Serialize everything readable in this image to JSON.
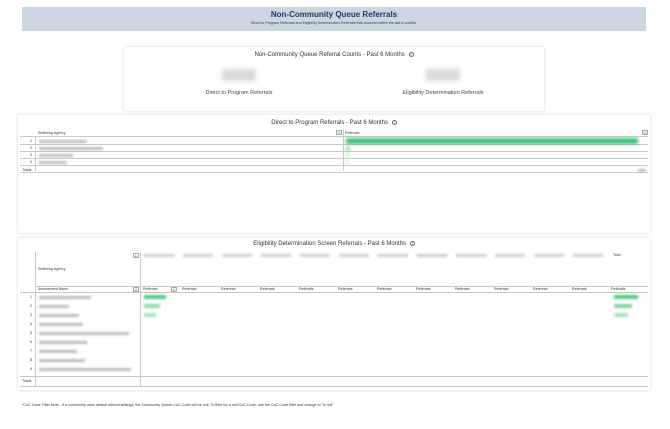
{
  "header": {
    "title": "Non-Community Queue Referrals",
    "subtitle": "Direct to Program Referrals and Eligibility Determination Referrals that occurred within the last 6 months."
  },
  "counts_card": {
    "title": "Non-Community Queue Referral Counts - Past 6 Months",
    "left_label": "Direct to Program Referrals",
    "right_label": "Eligibility Determination Referrals"
  },
  "direct_program": {
    "title": "Direct to Program Referrals - Past 6 Months",
    "col_agency": "Referring Agency",
    "col_referrals": "Referrals",
    "rows": [
      "1",
      "2",
      "3",
      "4"
    ],
    "totals": "Totals"
  },
  "eligibility": {
    "title": "Eligibility Determination Screen Referrals - Past 6 Months",
    "col_agency": "Referring Agency",
    "col_assessment": "Assessment Name",
    "col_total": "Total",
    "ref_header": "Referrals",
    "rows": [
      "1",
      "2",
      "3",
      "4",
      "5",
      "6",
      "7",
      "8",
      "9"
    ],
    "totals": "Totals"
  },
  "footnote": "*CoC Code Filter Note - If a community uses default referral settings, the Community Queue CoC Code will be null. To filter for a null CoC Code, use the CoC Code filter and change to \"is null\"",
  "icons": {
    "info": "info-icon",
    "sort": "sort-icon"
  },
  "colors": {
    "header_bg": "#ccd6e0",
    "title": "#1f3864",
    "bar": "#3bbf73"
  }
}
